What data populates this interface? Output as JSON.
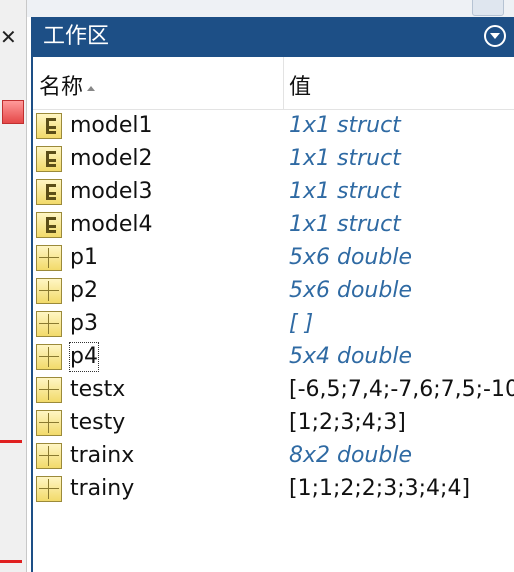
{
  "panel": {
    "title": "工作区"
  },
  "columns": {
    "name": "名称",
    "value": "值"
  },
  "variables": [
    {
      "name": "model1",
      "value": "1x1 struct",
      "kind": "struct",
      "style": "italic"
    },
    {
      "name": "model2",
      "value": "1x1 struct",
      "kind": "struct",
      "style": "italic"
    },
    {
      "name": "model3",
      "value": "1x1 struct",
      "kind": "struct",
      "style": "italic"
    },
    {
      "name": "model4",
      "value": "1x1 struct",
      "kind": "struct",
      "style": "italic"
    },
    {
      "name": "p1",
      "value": "5x6 double",
      "kind": "matrix",
      "style": "italic"
    },
    {
      "name": "p2",
      "value": "5x6 double",
      "kind": "matrix",
      "style": "italic"
    },
    {
      "name": "p3",
      "value": "[ ]",
      "kind": "matrix",
      "style": "italic"
    },
    {
      "name": "p4",
      "value": "5x4 double",
      "kind": "matrix",
      "style": "italic"
    },
    {
      "name": "testx",
      "value": "[-6,5;7,4;-7,6;7,5;-10",
      "kind": "matrix",
      "style": "plain"
    },
    {
      "name": "testy",
      "value": "[1;2;3;4;3]",
      "kind": "matrix",
      "style": "plain"
    },
    {
      "name": "trainx",
      "value": "8x2 double",
      "kind": "matrix",
      "style": "italic"
    },
    {
      "name": "trainy",
      "value": "[1;1;2;2;3;3;4;4]",
      "kind": "matrix",
      "style": "plain"
    }
  ],
  "colors": {
    "header": "#1d4f86",
    "italic_value": "#2f6aa3"
  },
  "icons": {
    "struct": "struct-icon",
    "matrix": "matrix-icon",
    "menu": "panel-menu-icon",
    "close": "close-icon"
  }
}
